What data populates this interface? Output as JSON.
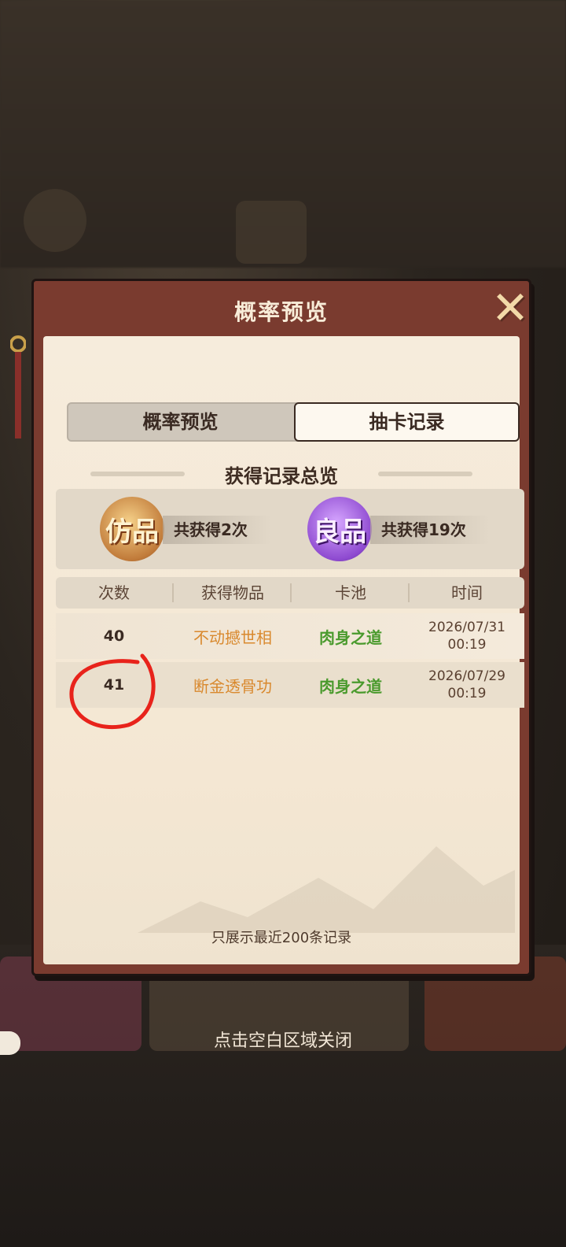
{
  "dialog": {
    "title": "概率预览",
    "close_icon": "close-x-icon",
    "tabs": [
      {
        "label": "概率预览",
        "active": false
      },
      {
        "label": "抽卡记录",
        "active": true
      }
    ],
    "section_title": "获得记录总览",
    "summary": [
      {
        "badge": "仿品",
        "text": "共获得2次",
        "color": "#c17b3a"
      },
      {
        "badge": "良品",
        "text": "共获得19次",
        "color": "#8e4ad0"
      }
    ],
    "table": {
      "headers": [
        "次数",
        "获得物品",
        "卡池",
        "时间"
      ],
      "rows": [
        {
          "count": "40",
          "item": "不动撼世相",
          "pool": "肉身之道",
          "date": "2026/07/31",
          "time": "00:19"
        },
        {
          "count": "41",
          "item": "断金透骨功",
          "pool": "肉身之道",
          "date": "2026/07/29",
          "time": "00:19"
        }
      ]
    },
    "footer_note": "只展示最近200条记录"
  },
  "close_hint": "点击空白区域关闭",
  "colors": {
    "item_orange": "#d9892e",
    "pool_green": "#4a9a2d",
    "panel_red": "#7a3b2f",
    "annotation_red": "#e8231b"
  }
}
